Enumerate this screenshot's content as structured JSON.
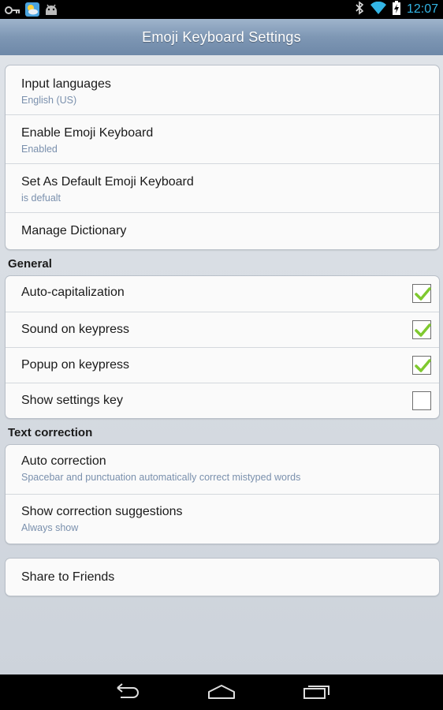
{
  "status_bar": {
    "time": "12:07",
    "left_icons": [
      "key-icon",
      "weather-icon",
      "android-icon"
    ],
    "right_icons": [
      "bluetooth-icon",
      "wifi-icon",
      "battery-charging-icon"
    ]
  },
  "title_bar": {
    "title": "Emoji Keyboard Settings"
  },
  "group1": [
    {
      "title": "Input languages",
      "summary": "English (US)"
    },
    {
      "title": "Enable Emoji Keyboard",
      "summary": "Enabled"
    },
    {
      "title": "Set As Default Emoji Keyboard",
      "summary": "is defualt"
    },
    {
      "title": "Manage Dictionary"
    }
  ],
  "general": {
    "header": "General",
    "items": [
      {
        "title": "Auto-capitalization",
        "checked": true
      },
      {
        "title": "Sound on keypress",
        "checked": true
      },
      {
        "title": "Popup on keypress",
        "checked": true
      },
      {
        "title": "Show settings key",
        "checked": false
      }
    ]
  },
  "text_correction": {
    "header": "Text correction",
    "items": [
      {
        "title": "Auto correction",
        "summary": "Spacebar and punctuation automatically correct mistyped words"
      },
      {
        "title": "Show correction suggestions",
        "summary": "Always show"
      }
    ]
  },
  "share": {
    "title": "Share to Friends"
  },
  "nav_bar": {
    "buttons": [
      "back-icon",
      "home-icon",
      "recent-apps-icon"
    ]
  },
  "colors": {
    "accent_blue": "#33b5e5",
    "summary_text": "#7a90ad",
    "check_green": "#7fc92f"
  }
}
